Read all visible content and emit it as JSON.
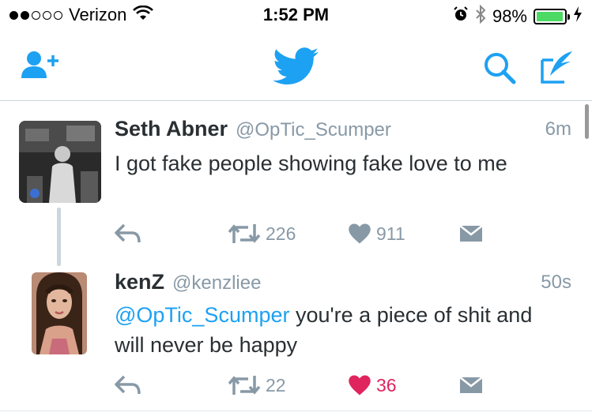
{
  "status_bar": {
    "carrier": "Verizon",
    "signal_strength": 2,
    "signal_max": 5,
    "time": "1:52 PM",
    "battery": "98%",
    "battery_level": 0.98
  },
  "nav": {
    "left_icon": "add-user-icon",
    "center_icon": "twitter-bird-icon",
    "right_icons": [
      "search-icon",
      "compose-icon"
    ],
    "accent_color": "#1da1f2"
  },
  "tweets": [
    {
      "name": "Seth Abner",
      "handle": "@OpTic_Scumper",
      "time": "6m",
      "text_parts": [
        {
          "type": "text",
          "value": "I got fake people showing fake love to me"
        }
      ],
      "retweets": "226",
      "likes": "911",
      "liked": false
    },
    {
      "name": "kenZ",
      "handle": "@kenzliee",
      "time": "50s",
      "text_parts": [
        {
          "type": "mention",
          "value": "@OpTic_Scumper"
        },
        {
          "type": "text",
          "value": " you're a piece of shit and will never be happy"
        }
      ],
      "retweets": "22",
      "likes": "36",
      "liked": true
    }
  ],
  "colors": {
    "accent": "#1da1f2",
    "muted": "#8899a6",
    "like_active": "#e0245e",
    "battery": "#4cd964"
  }
}
